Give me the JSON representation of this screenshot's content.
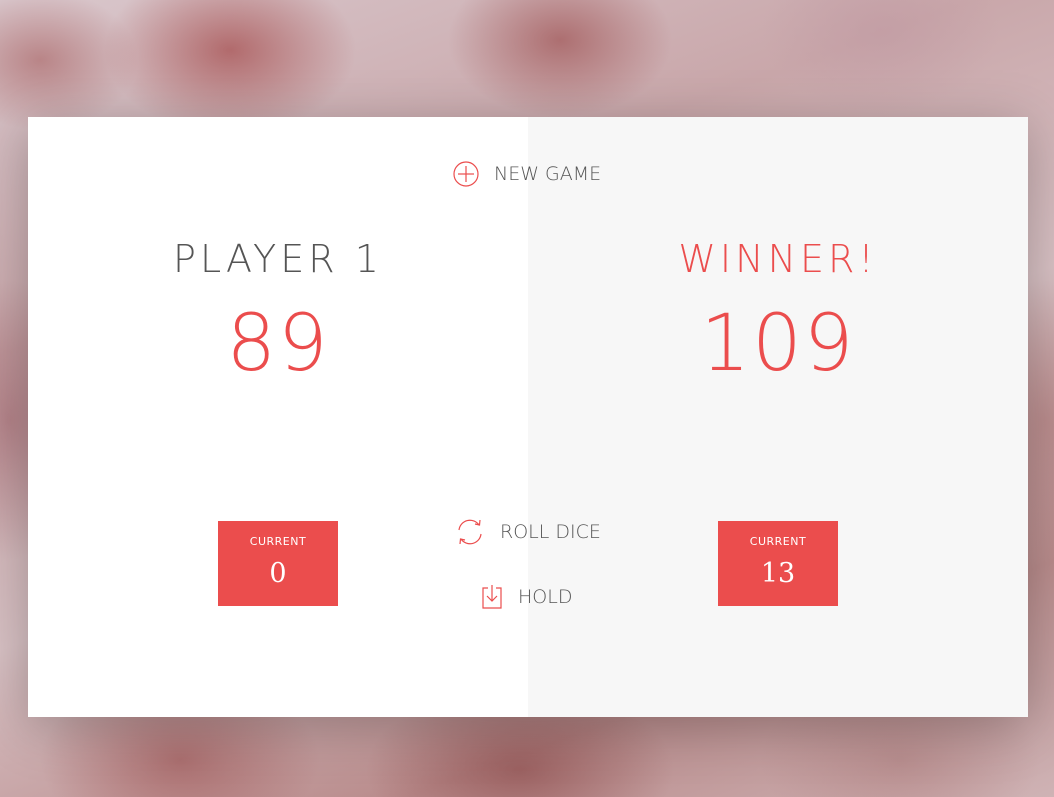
{
  "buttons": {
    "new_game": {
      "label": "NEW GAME",
      "icon": "plus-circle-icon"
    },
    "roll_dice": {
      "label": "ROLL DICE",
      "icon": "refresh-icon"
    },
    "hold": {
      "label": "HOLD",
      "icon": "download-icon"
    }
  },
  "players": [
    {
      "name": "PLAYER 1",
      "score": "89",
      "current_label": "CURRENT",
      "current_score": "0",
      "active": false,
      "winner": false
    },
    {
      "name": "WINNER!",
      "score": "109",
      "current_label": "CURRENT",
      "current_score": "13",
      "active": true,
      "winner": true
    }
  ],
  "colors": {
    "accent": "#eb4d4d",
    "text": "#555555",
    "panel_light": "#ffffff",
    "panel_active": "#f7f7f7"
  }
}
